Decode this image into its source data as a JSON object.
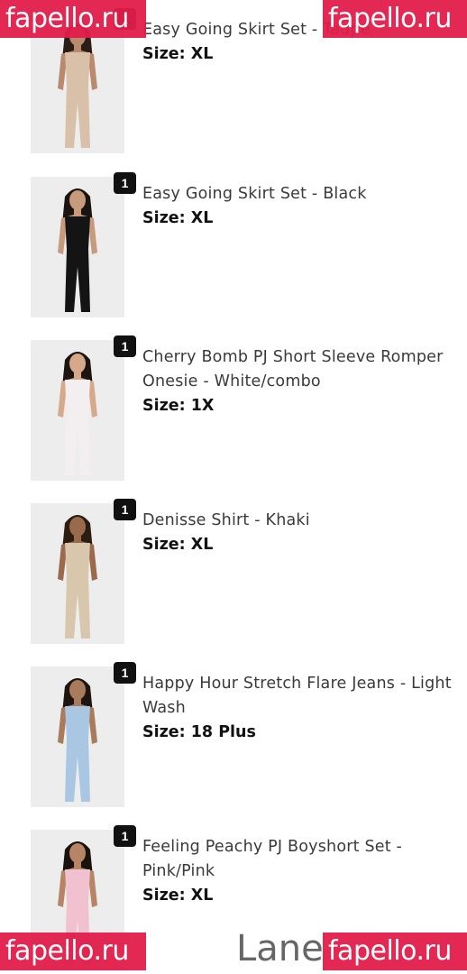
{
  "order_items": [
    {
      "name": "Easy Going Skirt Set - Taupe",
      "size_label": "Size:",
      "size": "XL",
      "quantity": "1",
      "outfit_color": "#d9c0a8",
      "skin": "#b98a6e",
      "hair": "#2a1d16"
    },
    {
      "name": "Easy Going Skirt Set - Black",
      "size_label": "Size:",
      "size": "XL",
      "quantity": "1",
      "outfit_color": "#141414",
      "skin": "#c89a7c",
      "hair": "#1a1410"
    },
    {
      "name": "Cherry Bomb PJ Short Sleeve Romper Onesie - White/combo",
      "size_label": "Size:",
      "size": "1X",
      "quantity": "1",
      "outfit_color": "#f3eef0",
      "skin": "#d6a98a",
      "hair": "#1b1410"
    },
    {
      "name": "Denisse Shirt - Khaki",
      "size_label": "Size:",
      "size": "XL",
      "quantity": "1",
      "outfit_color": "#d8c6ad",
      "skin": "#9a6a4c",
      "hair": "#2b1d12"
    },
    {
      "name": "Happy Hour Stretch Flare Jeans - Light Wash",
      "size_label": "Size:",
      "size": "18 Plus",
      "quantity": "1",
      "outfit_color": "#a9c7e3",
      "skin": "#a97a5c",
      "hair": "#1e1510"
    },
    {
      "name": "Feeling Peachy PJ Boyshort Set - Pink/Pink",
      "size_label": "Size:",
      "size": "XL",
      "quantity": "1",
      "outfit_color": "#f2c1cf",
      "skin": "#b58565",
      "hair": "#1a120c"
    }
  ],
  "watermark": {
    "text": "fapello.ru",
    "color": "#e11d4a"
  },
  "footer_name": "Lane"
}
